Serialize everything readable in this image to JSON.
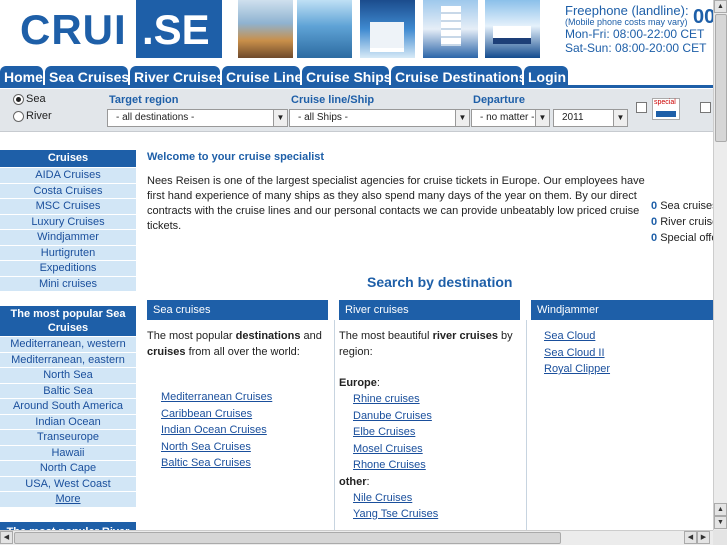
{
  "logo": {
    "part1": "CRUI",
    "part2": ".SE"
  },
  "phone": {
    "freephone": "Freephone (landline):",
    "mobile_note": "(Mobile phone costs may vary)",
    "weekday_hours": "Mon-Fri: 08:00-22:00 CET",
    "weekend_hours": "Sat-Sun: 08:00-20:00 CET",
    "number_partial": "00"
  },
  "nav": {
    "tabs": [
      "Home",
      "Sea Cruises",
      "River Cruises",
      "Cruise Line",
      "Cruise Ships",
      "Cruise Destinations",
      "Login"
    ]
  },
  "search": {
    "radio_sea": "Sea",
    "radio_river": "River",
    "target_region_label": "Target region",
    "target_region_value": "- all destinations -",
    "cruise_line_label": "Cruise line/Ship",
    "cruise_line_value": "- all Ships -",
    "departure_label": "Departure",
    "departure_value": "- no matter -",
    "year_value": "2011",
    "special_badge": "special"
  },
  "sidebar": {
    "cruises_title": "Cruises",
    "cruises": [
      "AIDA Cruises",
      "Costa Cruises",
      "MSC Cruises",
      "Luxury Cruises",
      "Windjammer",
      "Hurtigruten",
      "Expeditions",
      "Mini cruises"
    ],
    "popular_sea_title": "The most popular Sea Cruises",
    "popular_sea": [
      "Mediterranean, western",
      "Mediterranean, eastern",
      "North Sea",
      "Baltic Sea",
      "Around South America",
      "Indian Ocean",
      "Transeurope",
      "Hawaii",
      "North Cape",
      "USA, West Coast"
    ],
    "more": "More",
    "popular_river_title": "The most popular River"
  },
  "main": {
    "welcome_title": "Welcome to your cruise specialist",
    "welcome_text": "Nees Reisen is one of the largest specialist agencies for cruise tickets in Europe. Our employees have first hand experience of many ships as they also spend many days of the year on them. By our direct contracts with the cruise lines and our personal contacts we can provide unbeatably low priced cruise tickets.",
    "stats": [
      {
        "count": "0",
        "label": "Sea cruises"
      },
      {
        "count": "0",
        "label": "River cruise"
      },
      {
        "count": "0",
        "label": "Special offer"
      }
    ],
    "search_by_destination": "Search by destination",
    "sea_col": {
      "title": "Sea cruises",
      "intro_1": "The most popular ",
      "intro_bold_1": "destinations",
      "intro_2": " and ",
      "intro_bold_2": "cruises",
      "intro_3": " from all over the world:",
      "links": [
        "Mediterranean Cruises",
        "Caribbean Cruises",
        "Indian Ocean Cruises",
        "North Sea Cruises",
        "Baltic Sea Cruises"
      ]
    },
    "river_col": {
      "title": "River cruises",
      "intro_1": "The most beautiful ",
      "intro_bold": "river cruises",
      "intro_2": " by region:",
      "europe_label": "Europe",
      "europe_links": [
        "Rhine cruises",
        "Danube Cruises",
        "Elbe Cruises",
        "Mosel Cruises",
        "Rhone Cruises"
      ],
      "other_label": "other",
      "other_links": [
        "Nile Cruises",
        "Yang Tse Cruises"
      ]
    },
    "windjammer_col": {
      "title": "Windjammer",
      "links": [
        "Sea Cloud",
        "Sea Cloud II",
        "Royal Clipper"
      ]
    }
  }
}
